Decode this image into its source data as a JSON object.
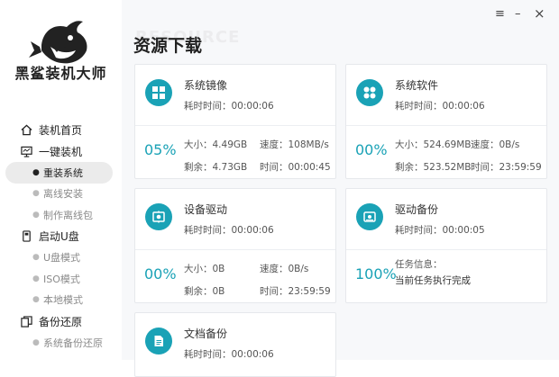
{
  "app": {
    "brand": "黑鲨装机大师"
  },
  "window_controls": {
    "menu": "≡",
    "minimize": "–",
    "close": "×"
  },
  "page": {
    "title": "资源下载",
    "watermark": "RESOURCE"
  },
  "sidebar": {
    "groups": [
      {
        "label": "装机首页",
        "icon": "home-icon",
        "subs": []
      },
      {
        "label": "一键装机",
        "icon": "monitor-icon",
        "subs": [
          {
            "label": "重装系统",
            "active": true
          },
          {
            "label": "离线安装"
          },
          {
            "label": "制作离线包"
          }
        ]
      },
      {
        "label": "启动U盘",
        "icon": "usb-icon",
        "subs": [
          {
            "label": "U盘模式"
          },
          {
            "label": "ISO模式"
          },
          {
            "label": "本地模式"
          }
        ]
      },
      {
        "label": "备份还原",
        "icon": "backup-icon",
        "subs": [
          {
            "label": "系统备份还原"
          }
        ]
      }
    ]
  },
  "cards": [
    {
      "name": "系统镜像",
      "icon": "windows-icon",
      "time": "耗时时间：00:00:06",
      "percent": "05%",
      "stats": [
        "大小：4.49GB",
        "速度：108MB/s",
        "剩余：4.73GB",
        "时间：00:00:45"
      ]
    },
    {
      "name": "系统软件",
      "icon": "apps-icon",
      "time": "耗时时间：00:00:06",
      "percent": "00%",
      "stats": [
        "大小：524.69MB",
        "速度：0B/s",
        "剩余：523.52MB",
        "时间：23:59:59"
      ]
    },
    {
      "name": "设备驱动",
      "icon": "driver-icon",
      "time": "耗时时间：00:00:06",
      "percent": "00%",
      "stats": [
        "大小：0B",
        "速度：0B/s",
        "剩余：0B",
        "时间：23:59:59"
      ]
    },
    {
      "name": "驱动备份",
      "icon": "disk-icon",
      "time": "耗时时间：00:00:05",
      "percent": "100%",
      "task_label": "任务信息：",
      "task_value": "当前任务执行完成"
    },
    {
      "name": "文档备份",
      "icon": "document-icon",
      "time": "耗时时间：00:00:06"
    }
  ],
  "colors": {
    "accent": "#1aa2b6",
    "active_bg": "#ebebeb",
    "main_bg": "#f7f8fa"
  }
}
